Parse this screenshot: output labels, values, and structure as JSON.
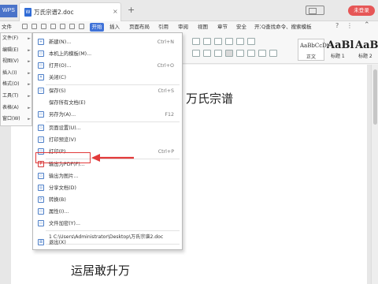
{
  "title_bar": {
    "app_label": "WPS",
    "doc_tab_title": "万氏宗谱2.doc",
    "new_tab_symbol": "+",
    "login_label": "未登录"
  },
  "menubar": {
    "file_label": "文件",
    "tabs": [
      "开始",
      "插入",
      "页面布局",
      "引用",
      "审阅",
      "视图",
      "章节",
      "安全",
      "开发工"
    ],
    "search_label": "Q查找命令、搜索模板",
    "help_symbol": "?",
    "more_symbol": "⋮",
    "collapse_symbol": "⌃"
  },
  "styles_gallery": {
    "normal": {
      "sample": "AaBbCcDt",
      "label": "正文"
    },
    "h1": {
      "sample": "AaBl",
      "label": "标题 1"
    },
    "h2": {
      "sample": "AaBl",
      "label": "标题 2"
    }
  },
  "file_submenu": [
    {
      "label": "文件(F)",
      "arrow": "►"
    },
    {
      "label": "编辑(E)",
      "arrow": "►"
    },
    {
      "label": "视图(V)",
      "arrow": "►"
    },
    {
      "label": "插入(I)",
      "arrow": "►"
    },
    {
      "label": "格式(O)",
      "arrow": "►"
    },
    {
      "label": "工具(T)",
      "arrow": "►"
    },
    {
      "label": "表格(A)",
      "arrow": "►"
    },
    {
      "label": "窗口(W)",
      "arrow": "►"
    }
  ],
  "dropdown": {
    "items": [
      {
        "label": "新建(N)...",
        "shortcut": "Ctrl+N",
        "icon": "+"
      },
      {
        "label": "本机上的模板(M)...",
        "shortcut": "",
        "icon": "▭"
      },
      {
        "label": "打开(O)...",
        "shortcut": "Ctrl+O",
        "icon": "▭"
      },
      {
        "label": "关闭(C)",
        "shortcut": "",
        "icon": "✕"
      },
      {
        "label": "保存(S)",
        "shortcut": "Ctrl+S",
        "icon": "▭"
      },
      {
        "label": "保存所有文档(E)",
        "shortcut": "",
        "icon": ""
      },
      {
        "label": "另存为(A)...",
        "shortcut": "F12",
        "icon": "▭"
      },
      {
        "label": "页面设置(U)...",
        "shortcut": "",
        "icon": "▭"
      },
      {
        "label": "打印预览(V)",
        "shortcut": "",
        "icon": "▭"
      },
      {
        "label": "打印(P)...",
        "shortcut": "Ctrl+P",
        "icon": "▭"
      },
      {
        "label": "输出为PDF(F)...",
        "shortcut": "",
        "icon": "P"
      },
      {
        "label": "输出为图片...",
        "shortcut": "",
        "icon": "▭"
      },
      {
        "label": "分享文档(D)",
        "shortcut": "",
        "icon": "◎"
      },
      {
        "label": "转换(B)",
        "shortcut": "",
        "icon": "⟳"
      },
      {
        "label": "属性(I)...",
        "shortcut": "",
        "icon": "▭"
      },
      {
        "label": "文件加密(Y)...",
        "shortcut": "",
        "icon": "▭"
      }
    ],
    "recent_file": "1 C:\\Users\\Administrator\\Desktop\\万氏宗谱2.doc",
    "exit": {
      "label": "退出(X)",
      "icon": "⊠"
    }
  },
  "document": {
    "heading": "万氏宗谱",
    "body_text": "运居敢升万"
  },
  "colors": {
    "accent_blue": "#3f72d8",
    "highlight_red": "#e23a3a",
    "login_red": "#e65656"
  }
}
